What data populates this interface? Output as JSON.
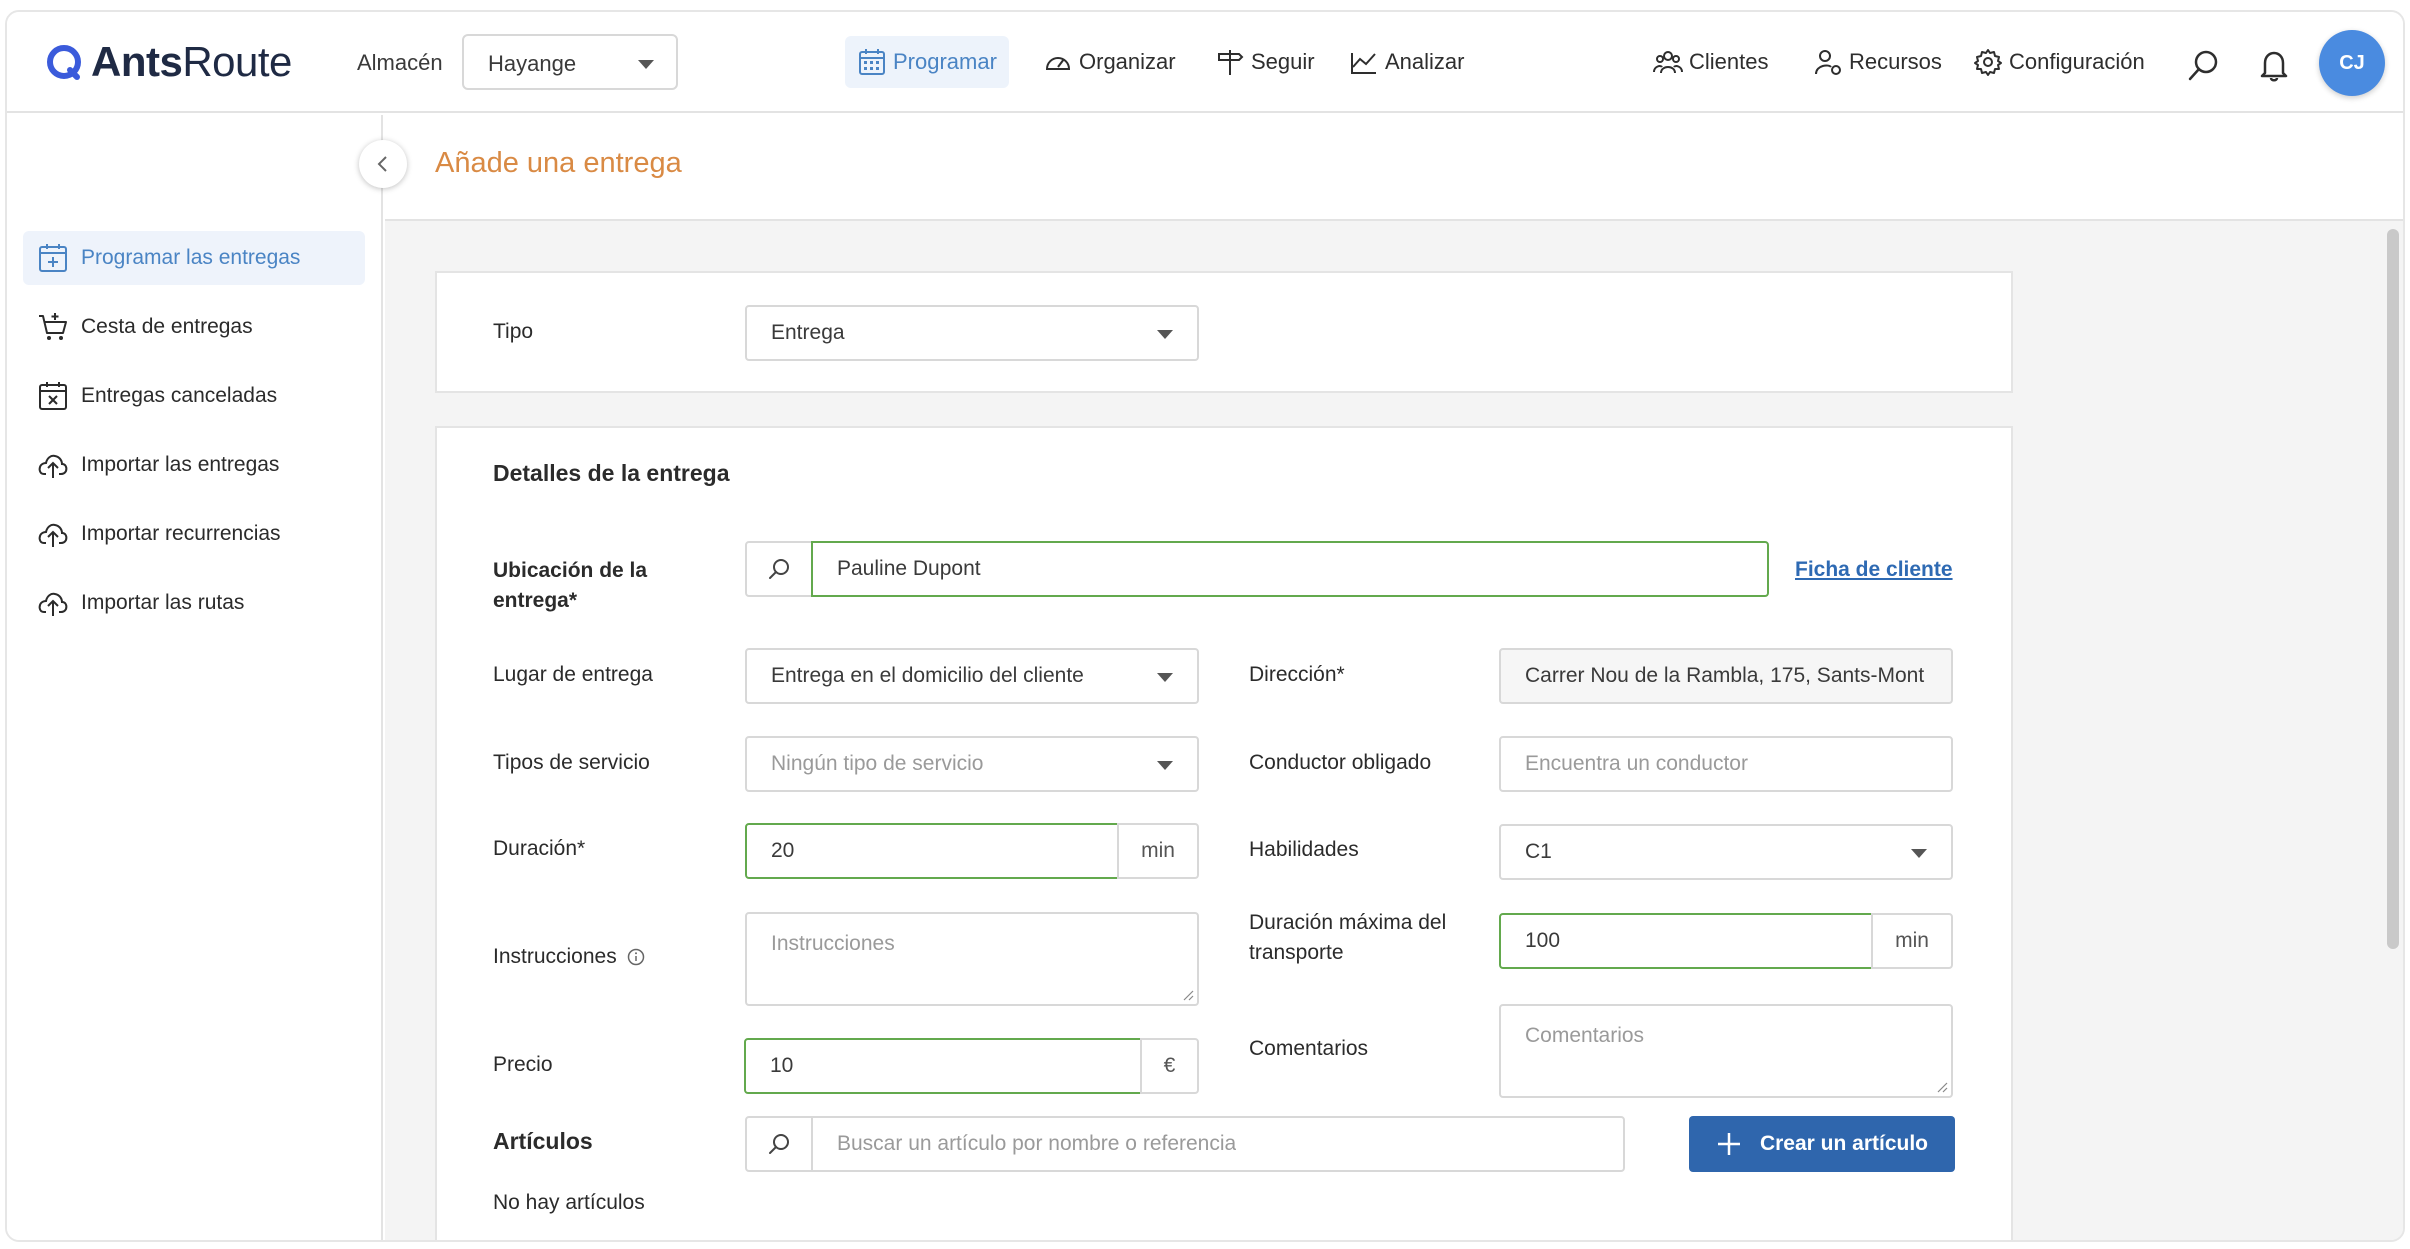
{
  "app": {
    "logo_bold": "Ants",
    "logo_light": "Route"
  },
  "header": {
    "warehouse_label": "Almacén",
    "warehouse_value": "Hayange",
    "nav": [
      "Programar",
      "Organizar",
      "Seguir",
      "Analizar"
    ],
    "right_nav": [
      "Clientes",
      "Recursos",
      "Configuración"
    ],
    "avatar": "CJ"
  },
  "sidebar": {
    "items": [
      "Programar las entregas",
      "Cesta de entregas",
      "Entregas canceladas",
      "Importar las entregas",
      "Importar recurrencias",
      "Importar las rutas"
    ]
  },
  "page": {
    "title": "Añade una entrega"
  },
  "type_card": {
    "label": "Tipo",
    "value": "Entrega"
  },
  "details": {
    "heading": "Detalles de la entrega",
    "location_label_1": "Ubicación de la",
    "location_label_2": "entrega*",
    "location_value": "Pauline Dupont",
    "client_link": "Ficha de cliente",
    "place_label": "Lugar de entrega",
    "place_value": "Entrega en el domicilio del cliente",
    "address_label": "Dirección*",
    "address_value": "Carrer Nou de la Rambla, 175, Sants-Mont",
    "service_label": "Tipos de servicio",
    "service_placeholder": "Ningún tipo de servicio",
    "driver_label": "Conductor obligado",
    "driver_placeholder": "Encuentra un conductor",
    "duration_label": "Duración*",
    "duration_value": "20",
    "duration_unit": "min",
    "skills_label": "Habilidades",
    "skills_value": "C1",
    "instructions_label": "Instrucciones",
    "instructions_placeholder": "Instrucciones",
    "max_transport_label_1": "Duración máxima del",
    "max_transport_label_2": "transporte",
    "max_transport_value": "100",
    "max_transport_unit": "min",
    "price_label": "Precio",
    "price_value": "10",
    "price_unit": "€",
    "comments_label": "Comentarios",
    "comments_placeholder": "Comentarios",
    "articles_heading": "Artículos",
    "articles_search_placeholder": "Buscar un artículo por nombre o referencia",
    "create_article_label": "Crear un artículo",
    "no_articles": "No hay artículos"
  },
  "colors": {
    "accent": "#4a84c4",
    "title": "#d98a44",
    "primary_button": "#2f66ad",
    "valid_border": "#63a94d"
  }
}
